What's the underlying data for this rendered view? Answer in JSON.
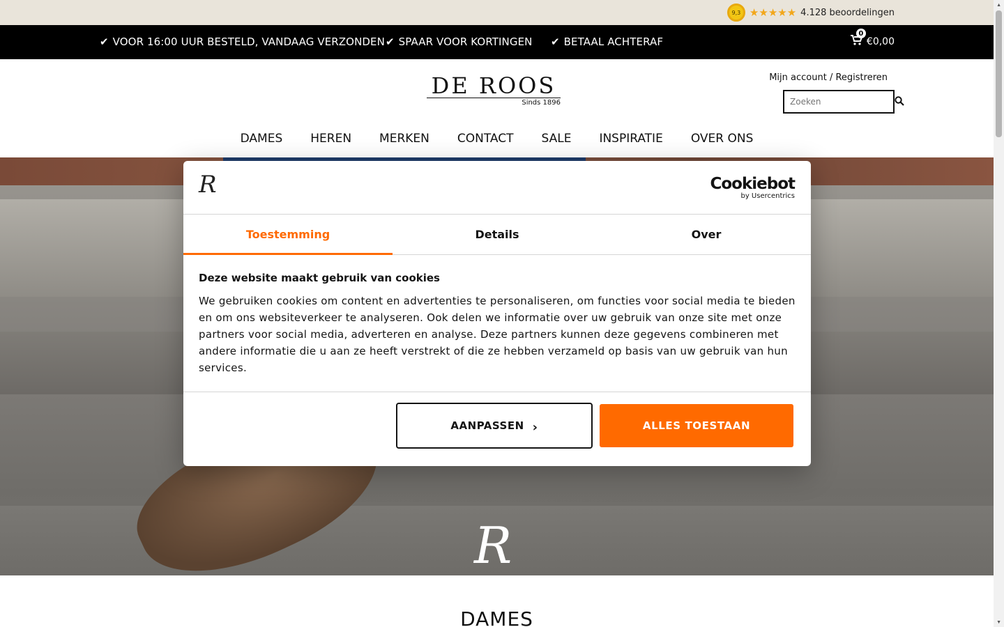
{
  "rating": {
    "score": "9,3",
    "stars": "★★★★★",
    "count_label": "4.128 beoordelingen"
  },
  "usp": [
    {
      "check": "✔",
      "label": "VOOR 16:00 UUR BESTELD, VANDAAG VERZONDEN"
    },
    {
      "check": "✔",
      "label": "SPAAR VOOR KORTINGEN"
    },
    {
      "check": "✔",
      "label": "BETAAL ACHTERAF"
    }
  ],
  "cart": {
    "count": "0",
    "total": "€0,00",
    "icon": "cart-icon"
  },
  "header": {
    "logo_main": "DE ROOS",
    "logo_sub": "Sinds 1896",
    "account_label": "Mijn account / Registreren",
    "search_placeholder": "Zoeken",
    "search_icon": "search-icon"
  },
  "nav": {
    "items": [
      "DAMES",
      "HEREN",
      "MERKEN",
      "CONTACT",
      "SALE",
      "INSPIRATIE",
      "OVER ONS"
    ]
  },
  "hero": {
    "mark": "R"
  },
  "section": {
    "title": "DAMES"
  },
  "cookie": {
    "logo_mark": "R",
    "brand_main": "Cookiebot",
    "brand_sub": "by Usercentrics",
    "tabs": [
      "Toestemming",
      "Details",
      "Over"
    ],
    "active_tab": "Toestemming",
    "title": "Deze website maakt gebruik van cookies",
    "text": "We gebruiken cookies om content en advertenties te personaliseren, om functies voor social media te bieden en om ons websiteverkeer te analyseren. Ook delen we informatie over uw gebruik van onze site met onze partners voor social media, adverteren en analyse. Deze partners kunnen deze gegevens combineren met andere informatie die u aan ze heeft verstrekt of die ze hebben verzameld op basis van uw gebruik van hun services.",
    "customize_label": "AANPASSEN",
    "customize_chevron": "›",
    "allow_label": "ALLES TOESTAAN"
  },
  "colors": {
    "accent": "#ff6a00",
    "usp_bar": "#000000",
    "rating_bar": "#e9e4da"
  }
}
